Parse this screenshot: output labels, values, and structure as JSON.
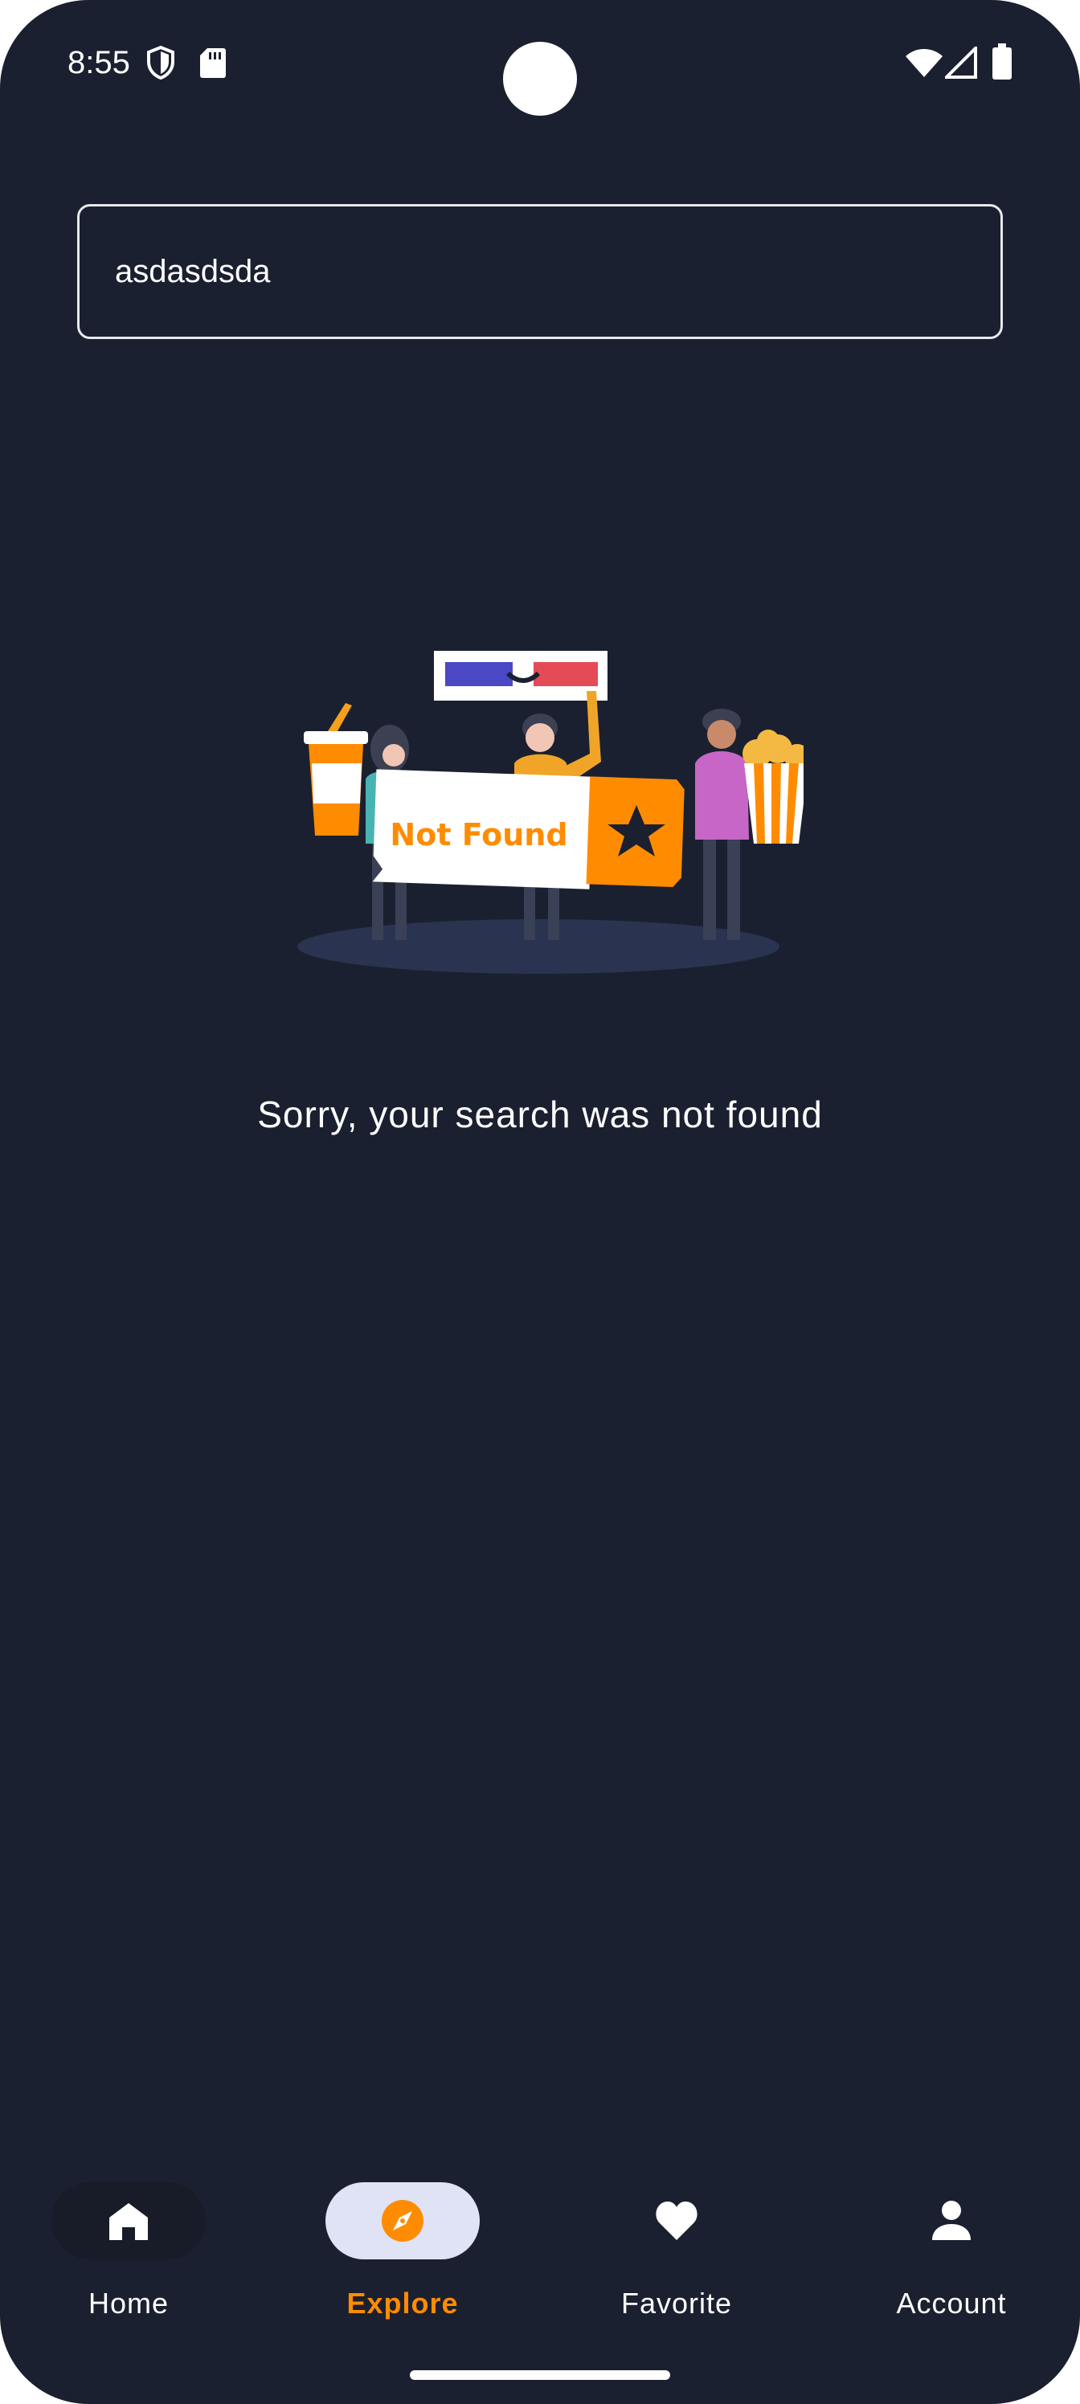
{
  "status_bar": {
    "time": "8:55",
    "icons": [
      "shield-icon",
      "sd-card-icon",
      "wifi-icon",
      "signal-icon",
      "battery-icon"
    ]
  },
  "search": {
    "value": "asdasdsda",
    "icon": "search-field"
  },
  "illustration": {
    "text": "Not Found",
    "icon": "not-found-illustration"
  },
  "empty_state": {
    "message": "Sorry, your search was not found"
  },
  "bottom_nav": {
    "items": [
      {
        "label": "Home",
        "icon": "home-icon",
        "active": false
      },
      {
        "label": "Explore",
        "icon": "compass-icon",
        "active": true
      },
      {
        "label": "Favorite",
        "icon": "heart-icon",
        "active": false
      },
      {
        "label": "Account",
        "icon": "person-icon",
        "active": false
      }
    ]
  },
  "colors": {
    "background": "#1b2030",
    "accent": "#ff8c00",
    "active_pill": "#dfe3f5",
    "text": "#ffffff"
  }
}
